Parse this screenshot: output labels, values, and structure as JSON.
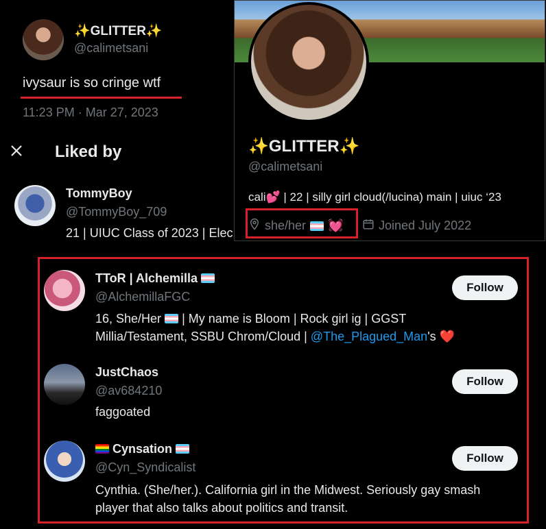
{
  "tweet": {
    "display_name": "✨GLITTER✨",
    "handle": "@calimetsani",
    "text": "ivysaur is so cringe wtf",
    "timestamp": "11:23 PM · Mar 27, 2023"
  },
  "liked_by": {
    "title": "Liked by",
    "close_icon": "close-icon"
  },
  "users": [
    {
      "name": "TommyBoy",
      "handle": "@TommyBoy_709",
      "bio": "21 | UIUC Class of 2023 | Elec"
    },
    {
      "name": "TToR | Alchemilla",
      "handle": "@AlchemillaFGC",
      "bio_line1_a": "16, She/Her",
      "bio_line1_b": "| My name is Bloom | Rock girl ig | GGST",
      "bio_line2_a": "Millia/Testament, SSBU Chrom/Cloud |",
      "bio_mention": "@The_Plagued_Man",
      "bio_line2_b": "'s",
      "follow": "Follow"
    },
    {
      "name": "JustChaos",
      "handle": "@av684210",
      "bio": "faggoated",
      "follow": "Follow"
    },
    {
      "name": "Cynsation",
      "handle": "@Cyn_Syndicalist",
      "bio": "Cynthia. (She/her.). California girl in the Midwest. Seriously gay smash player that also talks about politics and transit.",
      "follow": "Follow"
    }
  ],
  "profile_card": {
    "display_name": "✨GLITTER✨",
    "handle": "@calimetsani",
    "bio_a": "cali",
    "bio_b": "| 22 | silly girl cloud(/lucina) main | uiuc ‘23",
    "location": "she/her",
    "joined": "Joined July 2022"
  },
  "colors": {
    "highlight_red": "#d6202a",
    "link_blue": "#1d9bf0",
    "muted": "#71767b"
  }
}
